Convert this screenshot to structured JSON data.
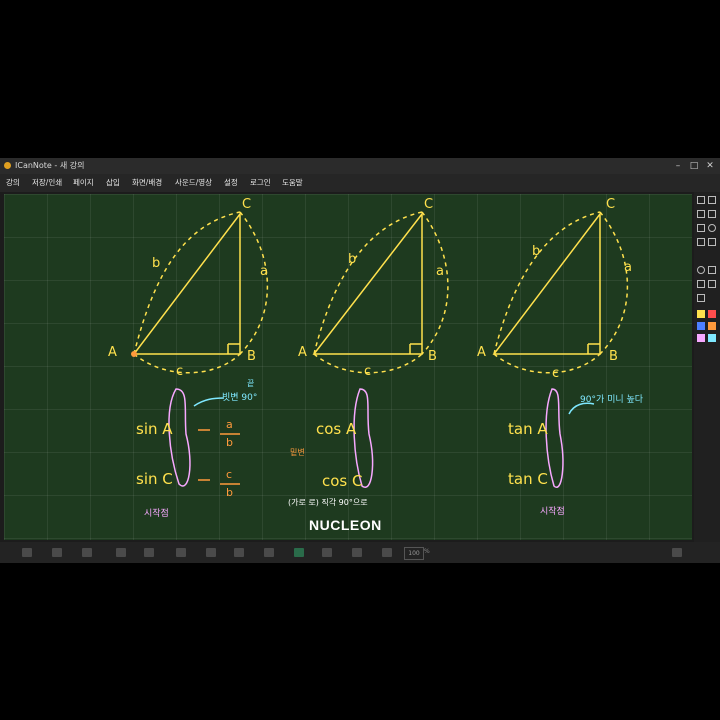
{
  "window": {
    "title": "ICanNote - 새 강의",
    "controls": [
      "minimize-icon",
      "maximize-icon",
      "close-icon"
    ]
  },
  "menu": [
    "강의",
    "저장/인쇄",
    "페이지",
    "삽입",
    "화면/배경",
    "사운드/영상",
    "설정",
    "로그인",
    "도움말"
  ],
  "board": {
    "vertex_labels": [
      "A",
      "B",
      "C"
    ],
    "side_labels": [
      "a",
      "b",
      "c"
    ],
    "notes": {
      "sin_a": "sin A",
      "sin_c": "sin C",
      "frac_a_num": "a",
      "frac_a_den": "b",
      "frac_c_num": "c",
      "frac_c_den": "b",
      "ref_note": "빗변 90°",
      "above_note": "끝",
      "bottom_left": "시작점",
      "cos_a": "cos A",
      "cos_c": "cos C",
      "side_note": "밑변",
      "cos_bottom": "(가로 로) 직각 90°으로",
      "tan_a": "tan A",
      "tan_c": "tan C",
      "tan_note": "90°가 미니 높다",
      "tan_bottom": "시작점"
    },
    "watermark": "NUCLEON"
  },
  "bottom": {
    "zoom": "100",
    "pct": "%"
  },
  "colors": {
    "board": "#1e3a1f",
    "chalk_yellow": "#ffe14d",
    "chalk_orange": "#ff9a3c",
    "chalk_cyan": "#7fe8ff",
    "chalk_pink": "#f7a8ff"
  }
}
